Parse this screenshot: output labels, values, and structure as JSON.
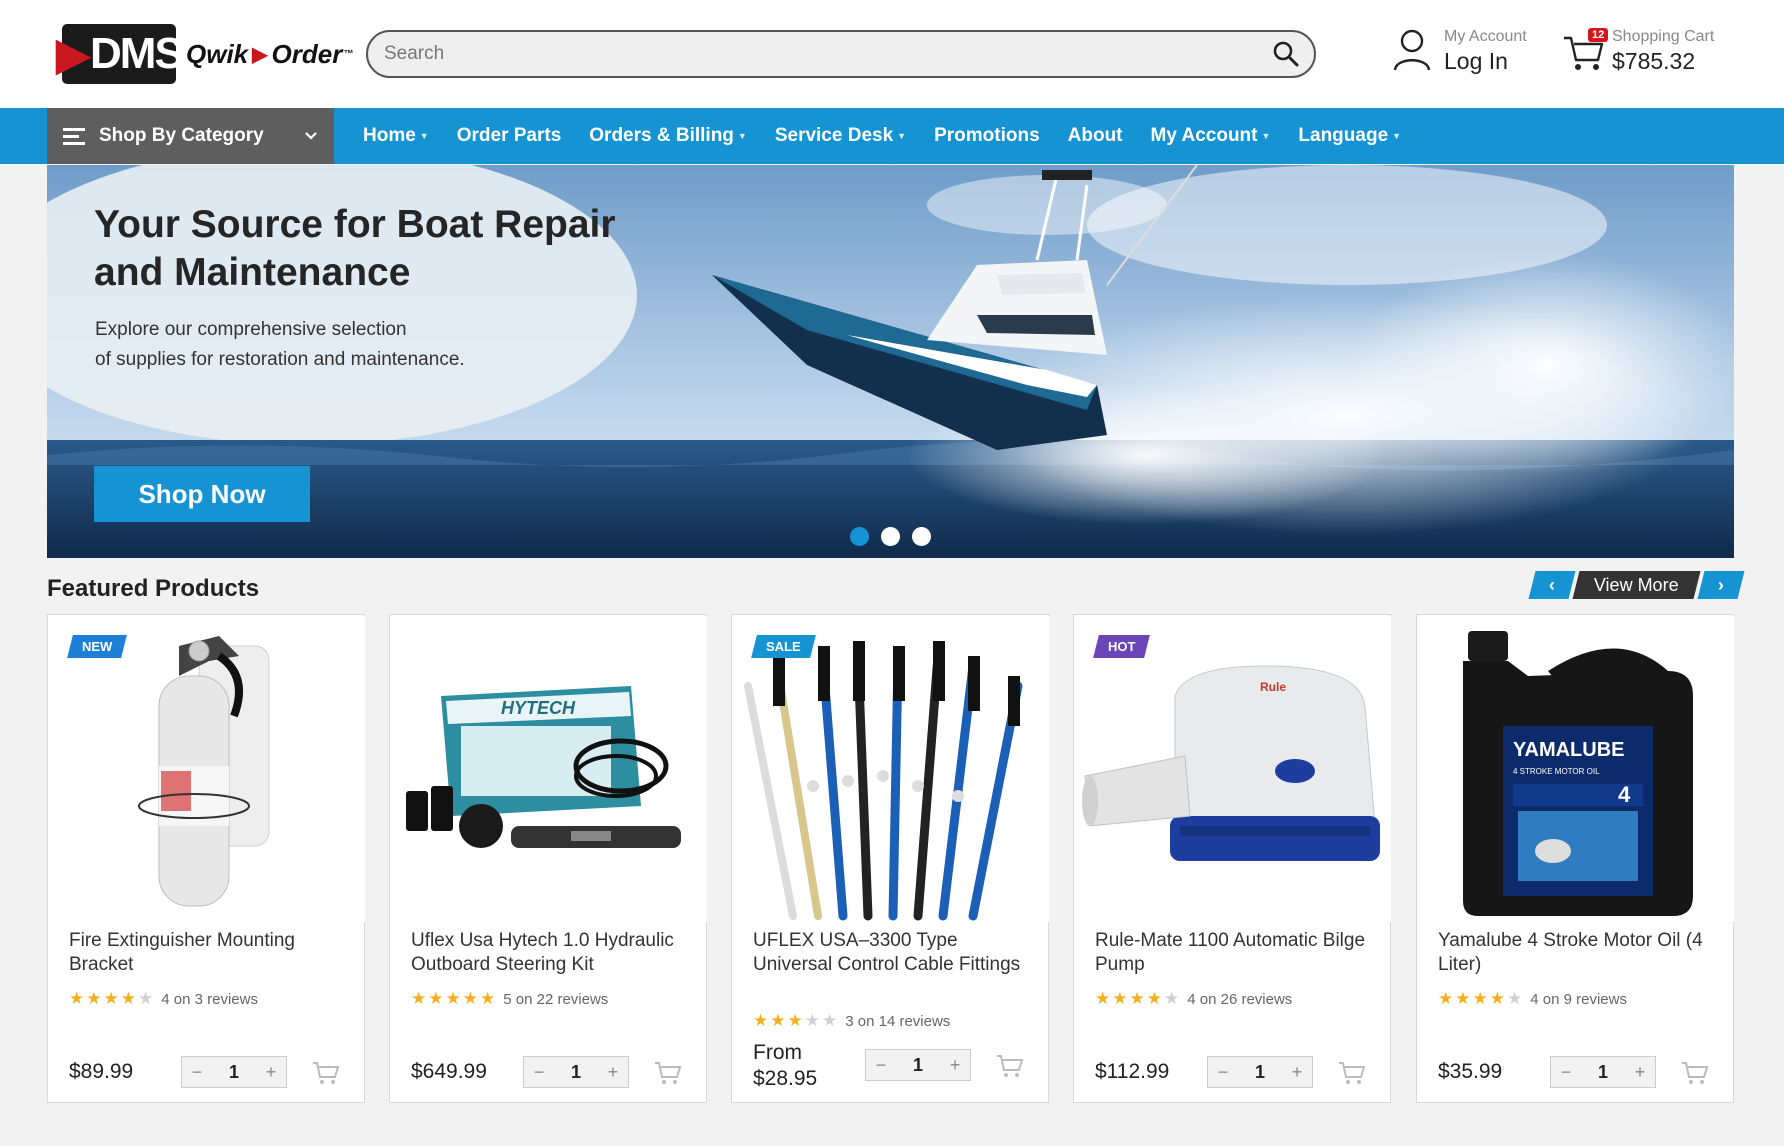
{
  "brand": {
    "logo_text": "DMS",
    "product_name_1": "Qwik",
    "product_name_2": "Order",
    "tm": "™"
  },
  "search": {
    "placeholder": "Search"
  },
  "account": {
    "sub_label": "My Account",
    "main_label": "Log In"
  },
  "cart": {
    "sub_label": "Shopping Cart",
    "total": "$785.32",
    "count": "12"
  },
  "nav": {
    "category_label": "Shop By Category",
    "items": [
      {
        "label": "Home",
        "has_caret": true
      },
      {
        "label": "Order Parts",
        "has_caret": false
      },
      {
        "label": "Orders & Billing",
        "has_caret": true
      },
      {
        "label": "Service Desk",
        "has_caret": true
      },
      {
        "label": "Promotions",
        "has_caret": false
      },
      {
        "label": "About",
        "has_caret": false
      },
      {
        "label": "My Account",
        "has_caret": true
      },
      {
        "label": "Language",
        "has_caret": true
      }
    ]
  },
  "hero": {
    "title": "Your Source for Boat Repair and Maintenance",
    "subtitle_line1": "Explore our comprehensive selection",
    "subtitle_line2": "of supplies for restoration and maintenance.",
    "cta": "Shop Now",
    "slides": 3,
    "active_slide": 1
  },
  "featured": {
    "title": "Featured Products",
    "view_more": "View More",
    "prev_icon": "‹",
    "next_icon": "›",
    "products": [
      {
        "name": "Fire Extinguisher Mounting Bracket",
        "badge": "NEW",
        "rating": 4,
        "reviews": "4 on 3 reviews",
        "price": "$89.99",
        "qty": "1"
      },
      {
        "name": "Uflex Usa Hytech 1.0 Hydraulic Outboard Steering Kit",
        "badge": "",
        "rating": 5,
        "reviews": "5 on 22 reviews",
        "price": "$649.99",
        "qty": "1"
      },
      {
        "name": "UFLEX USA–3300 Type Universal Control Cable Fittings",
        "badge": "SALE",
        "rating": 3,
        "reviews": "3 on 14 reviews",
        "price_prefix": "From",
        "price": "$28.95",
        "qty": "1"
      },
      {
        "name": "Rule-Mate 1100 Automatic Bilge Pump",
        "badge": "HOT",
        "rating": 4,
        "reviews": "4 on 26 reviews",
        "price": "$112.99",
        "qty": "1"
      },
      {
        "name": "Yamalube 4 Stroke Motor Oil (4 Liter)",
        "badge": "",
        "rating": 4,
        "reviews": "4 on 9 reviews",
        "price": "$35.99",
        "qty": "1"
      }
    ],
    "image_labels": {
      "hytech": "HYTECH",
      "yamalube": "YAMALUBE",
      "yamalube_sub": "4 STROKE MOTOR OIL",
      "yamalube_num": "4"
    }
  },
  "colors": {
    "accent": "#1593d3",
    "nav_dark": "#5e5e5e",
    "star": "#f2b01e",
    "badge_red": "#d5161e",
    "badge_hot": "#6b46b8"
  }
}
